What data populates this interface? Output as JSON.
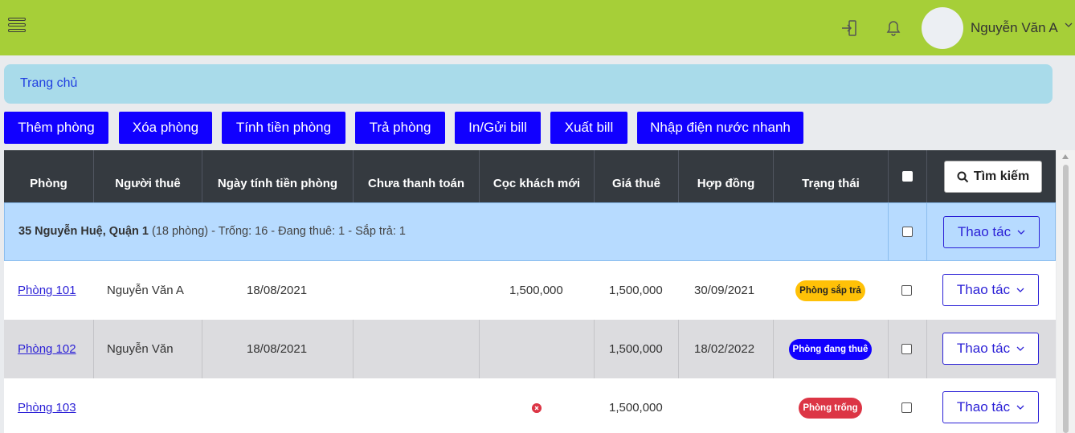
{
  "header": {
    "user_name": "Nguyễn Văn A",
    "bg_color": "#a6cf38",
    "icons": [
      "menu-icon",
      "logout-icon",
      "bell-icon",
      "chevron-down-icon"
    ]
  },
  "breadcrumb": {
    "home": "Trang chủ"
  },
  "toolbar": {
    "buttons": [
      "Thêm phòng",
      "Xóa phòng",
      "Tính tiền phòng",
      "Trả phòng",
      "In/Gửi bill",
      "Xuất bill",
      "Nhập điện nước nhanh"
    ],
    "color": "#1100ff"
  },
  "table": {
    "headers": [
      "Phòng",
      "Người thuê",
      "Ngày tính tiền phòng",
      "Chưa thanh toán",
      "Cọc khách mới",
      "Giá thuê",
      "Hợp đồng",
      "Trạng thái"
    ],
    "search_label": "Tìm kiếm",
    "action_label": "Thao tác",
    "group": {
      "name": "35 Nguyễn Huệ, Quận 1",
      "summary": " (18 phòng) - Trống: 16 - Đang thuê: 1 - Sắp trả: 1"
    },
    "rows": [
      {
        "room": "Phòng 101",
        "tenant": "Nguyễn Văn A",
        "billing_date": "18/08/2021",
        "unpaid": "",
        "deposit": "1,500,000",
        "price": "1,500,000",
        "contract": "30/09/2021",
        "status": "Phòng sắp trả"
      },
      {
        "room": "Phòng 102",
        "tenant": "Nguyễn Văn",
        "billing_date": "18/08/2021",
        "unpaid": "",
        "deposit": "",
        "price": "1,500,000",
        "contract": "18/02/2022",
        "status": "Phòng đang thuê"
      },
      {
        "room": "Phòng 103",
        "tenant": "",
        "billing_date": "",
        "unpaid": "",
        "deposit": "",
        "price": "1,500,000",
        "contract": "",
        "status": "Phòng trống"
      }
    ]
  },
  "colors": {
    "status_soon": "#ffc107",
    "status_rented": "#1100ff",
    "status_empty": "#dc3545",
    "header_dark": "#353a40"
  }
}
